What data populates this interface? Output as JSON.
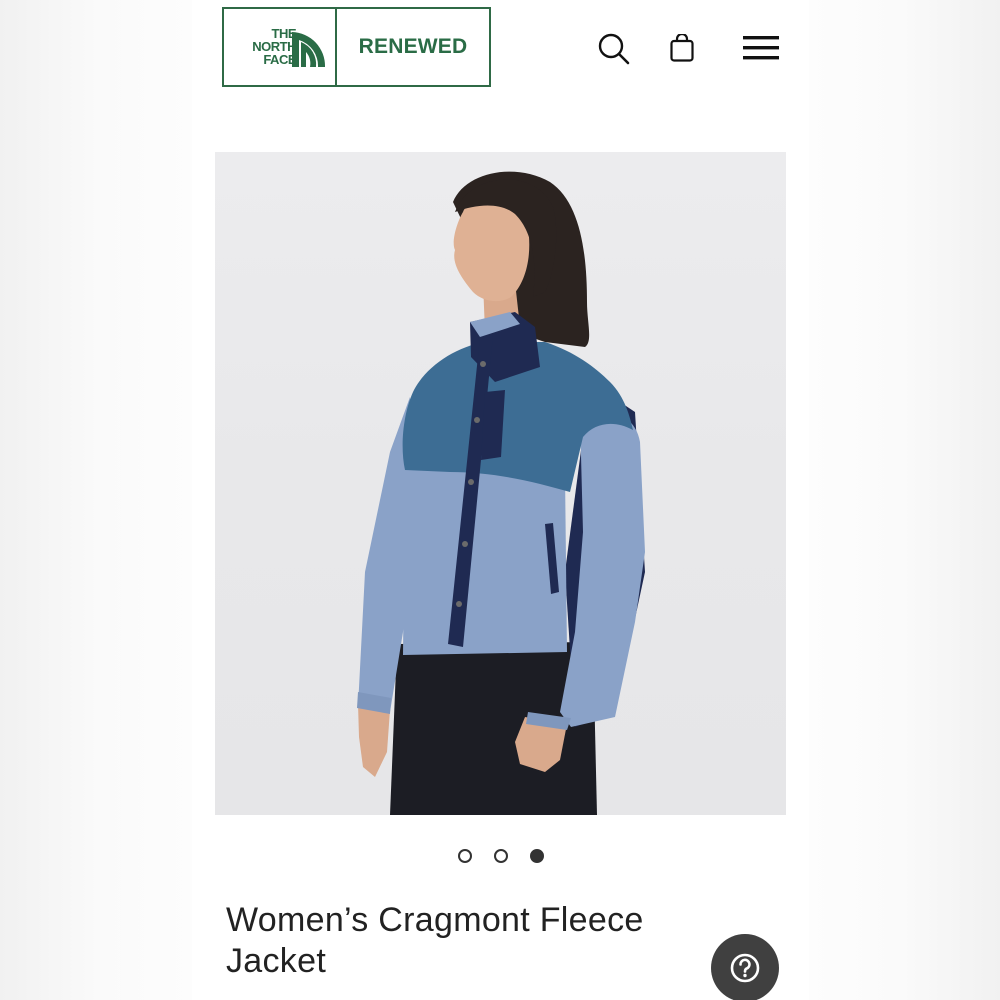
{
  "brand": {
    "logo_line1": "THE",
    "logo_line2": "NORTH",
    "logo_line3": "FACE",
    "program": "RENEWED",
    "color": "#2a6c46"
  },
  "header": {
    "icons": [
      "search-icon",
      "shopping-bag-icon",
      "hamburger-menu-icon"
    ]
  },
  "product_image": {
    "icon": "product-photo",
    "colors": {
      "body_light": "#8aa2c8",
      "yoke_dark": "#3d6d94",
      "trim_navy": "#1f2a52",
      "pants": "#1c1d24"
    }
  },
  "carousel": {
    "total": 3,
    "active": 3
  },
  "product": {
    "title": "Women’s Cragmont Fleece Jacket"
  },
  "help": {
    "icon": "question-icon"
  }
}
